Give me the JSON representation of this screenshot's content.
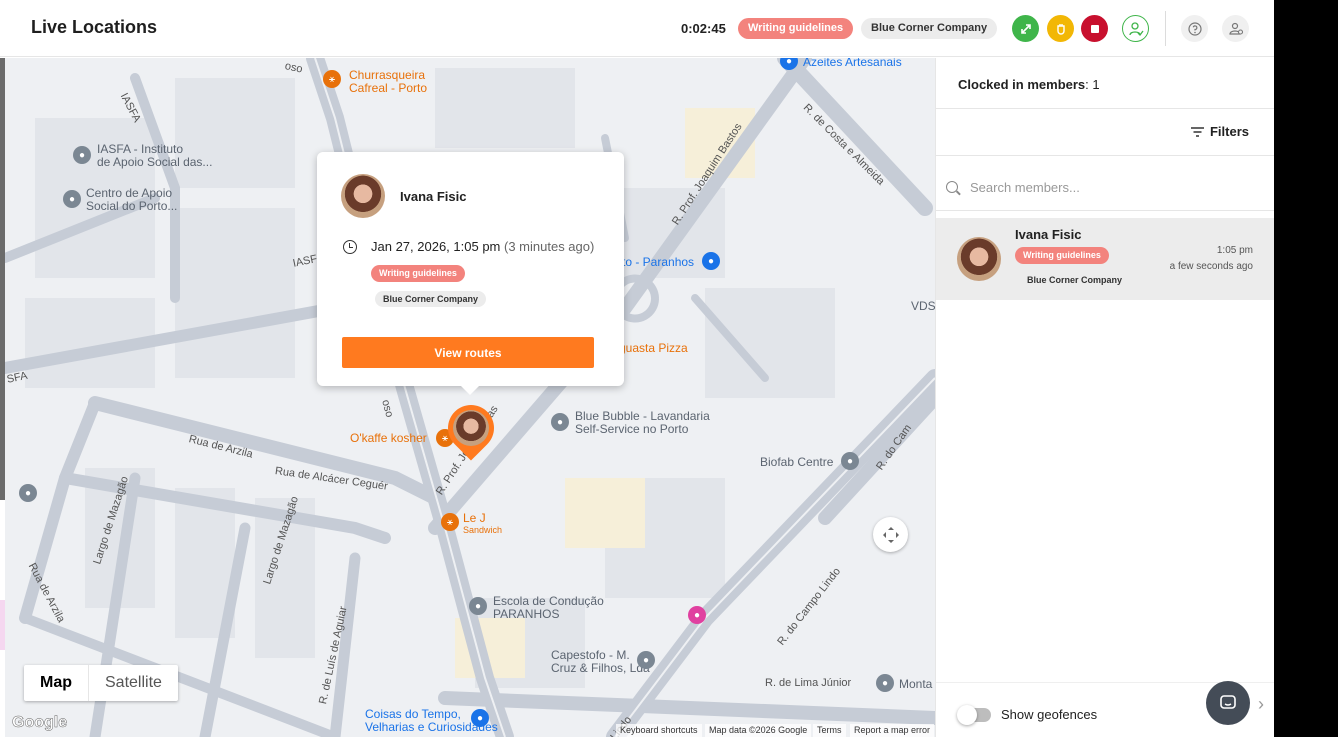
{
  "header": {
    "title": "Live Locations",
    "timer": "0:02:45",
    "project_badge": "Writing guidelines",
    "company_badge": "Blue Corner Company",
    "colors": {
      "green": "#3fb54a",
      "yellow": "#f2b705",
      "red": "#c8102e",
      "accent": "#ff7a1f"
    },
    "icons": [
      "switch-task-icon",
      "break-icon",
      "stop-icon",
      "clocked-members-icon",
      "help-icon",
      "user-settings-icon"
    ]
  },
  "map": {
    "type_buttons": {
      "map": "Map",
      "satellite": "Satellite"
    },
    "pois": {
      "churrasqueira": "Churrasqueira\nCafreal - Porto",
      "iasfa": "IASFA - Instituto\nde Apoio Social das...",
      "centro": "Centro de Apoio\nSocial do Porto...",
      "azeites": "Azeites Artesanais",
      "paranhos": "to - Paranhos",
      "pizza": "guasta Pizza",
      "okaffe": "O'kaffe kosher",
      "bluebubble": "Blue Bubble - Lavandaria\nSelf-Service no Porto",
      "biofab": "Biofab Centre",
      "lej": "Le J",
      "lej_sub": "Sandwich",
      "escola": "Escola de Condução\nPARANHOS",
      "capestofo": "Capestofo - M.\nCruz & Filhos, Lda",
      "coisas": "Coisas do Tempo,\nVelharias e Curiosidades",
      "monta": "Monta",
      "vds": "VDS"
    },
    "streets": {
      "costa": "R. de Costa e Almeida",
      "joaquim": "R. Prof. Joaquim Bastos",
      "joaquim2": "R. Prof. Joaquim Bas",
      "arzila": "Rua de Arzila",
      "alcacer": "Rua de Alcácer Ceguér",
      "campolindo": "R. do Campo Lindo",
      "docam": "R. do Cam",
      "mazagao": "Largo de Mazagão",
      "mazagao2": "Largo de Mazagão",
      "luis": "R. de Luís de Aguiar",
      "arzila2": "Rua de Arzila",
      "limajunior": "R. de Lima Júnior",
      "iasfa_road": "IASFA",
      "iasf2": "IASF",
      "sfa": "SFA",
      "oso": "oso",
      "oso2": "oso",
      "lindo": "Lindo"
    },
    "attribution": {
      "shortcuts": "Keyboard shortcuts",
      "mapdata": "Map data ©2026 Google",
      "terms": "Terms",
      "report": "Report a map error"
    },
    "logo": "Google",
    "popup": {
      "name": "Ivana Fisic",
      "datetime": "Jan 27, 2026, 1:05 pm",
      "ago": "(3 minutes ago)",
      "project": "Writing guidelines",
      "company": "Blue Corner Company",
      "button": "View routes"
    }
  },
  "sidebar": {
    "clocked_label": "Clocked in members",
    "clocked_count": ": 1",
    "filters_label": "Filters",
    "search_placeholder": "Search members...",
    "members": [
      {
        "name": "Ivana Fisic",
        "project": "Writing guidelines",
        "company": "Blue Corner Company",
        "time": "1:05 pm",
        "ago": "a few seconds ago"
      }
    ],
    "geofence_label": "Show geofences"
  }
}
